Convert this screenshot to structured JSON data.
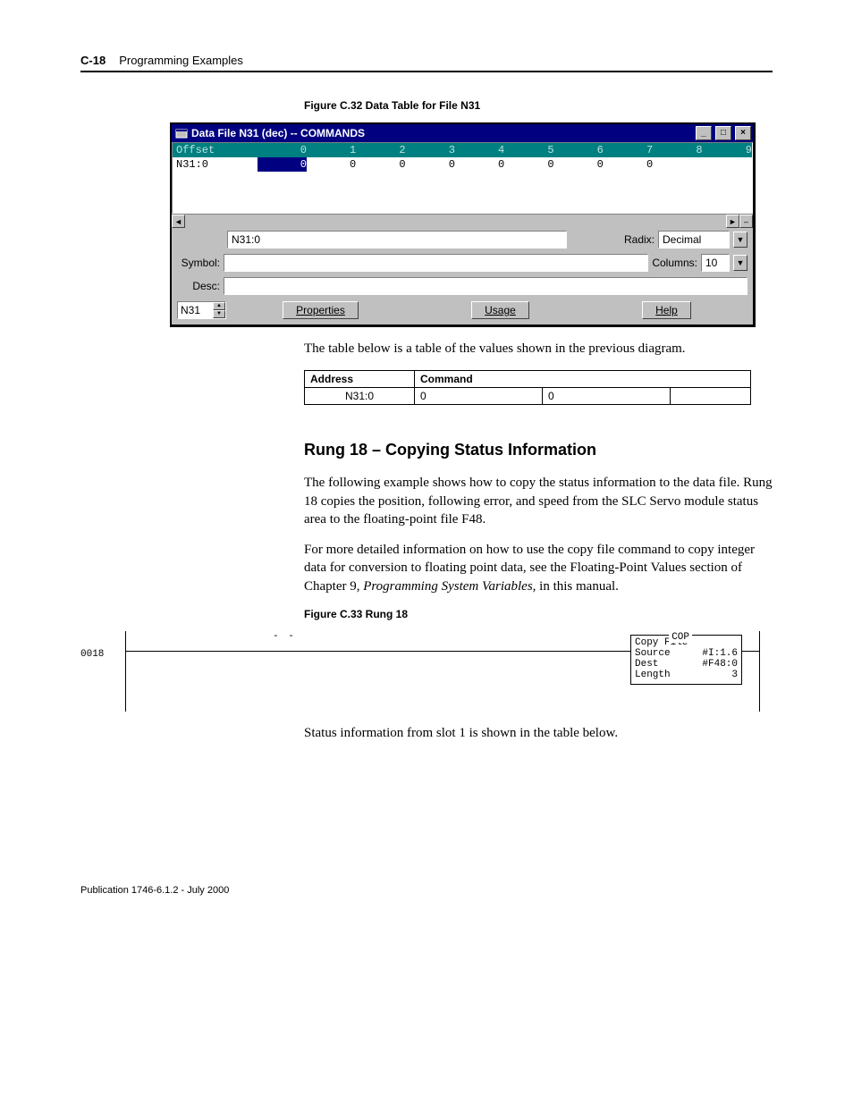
{
  "header": {
    "page_number": "C-18",
    "section": "Programming Examples"
  },
  "figure_c32": {
    "caption": "Figure C.32 Data Table for File N31",
    "window_title": "Data File N31 (dec)  --  COMMANDS",
    "grid": {
      "offset_header": "Offset",
      "columns": [
        "0",
        "1",
        "2",
        "3",
        "4",
        "5",
        "6",
        "7",
        "8",
        "9"
      ],
      "row_address": "N31:0",
      "row_values": [
        "0",
        "0",
        "0",
        "0",
        "0",
        "0",
        "0",
        "0",
        "",
        ""
      ]
    },
    "address_field_value": "N31:0",
    "symbol_label": "Symbol:",
    "desc_label": "Desc:",
    "radix_label": "Radix:",
    "radix_value": "Decimal",
    "columns_label": "Columns:",
    "columns_value": "10",
    "file_spinner": "N31",
    "btn_properties": "Properties",
    "btn_usage": "Usage",
    "btn_help": "Help"
  },
  "para1": "The table below is a table of the values shown in the previous diagram.",
  "small_table": {
    "headers": [
      "Address",
      "Command"
    ],
    "row": {
      "address": "N31:0",
      "c1": "0",
      "c2": "0",
      "c3": ""
    }
  },
  "h2": "Rung 18 – Copying Status Information",
  "para2": "The following example shows how to copy the status information to the data file.  Rung 18 copies the position, following error, and speed from the SLC Servo module status area to the floating-point file F48.",
  "para3a": "For more detailed information on how to use the copy file command to copy integer data for conversion to floating point data, see the Floating-Point Values section of Chapter 9, ",
  "para3_italic": "Programming System Variables,",
  "para3b": "  in this manual.",
  "figure_c33": {
    "caption": "Figure C.33  Rung 18",
    "rung_number": "0018",
    "cop_label": "COP",
    "cop_title": "Copy File",
    "source_label": "Source",
    "source_value": "#I:1.6",
    "dest_label": "Dest",
    "dest_value": "#F48:0",
    "length_label": "Length",
    "length_value": "3"
  },
  "para4": "Status information from slot 1 is shown in the table below.",
  "footer": "Publication 1746-6.1.2 - July 2000"
}
